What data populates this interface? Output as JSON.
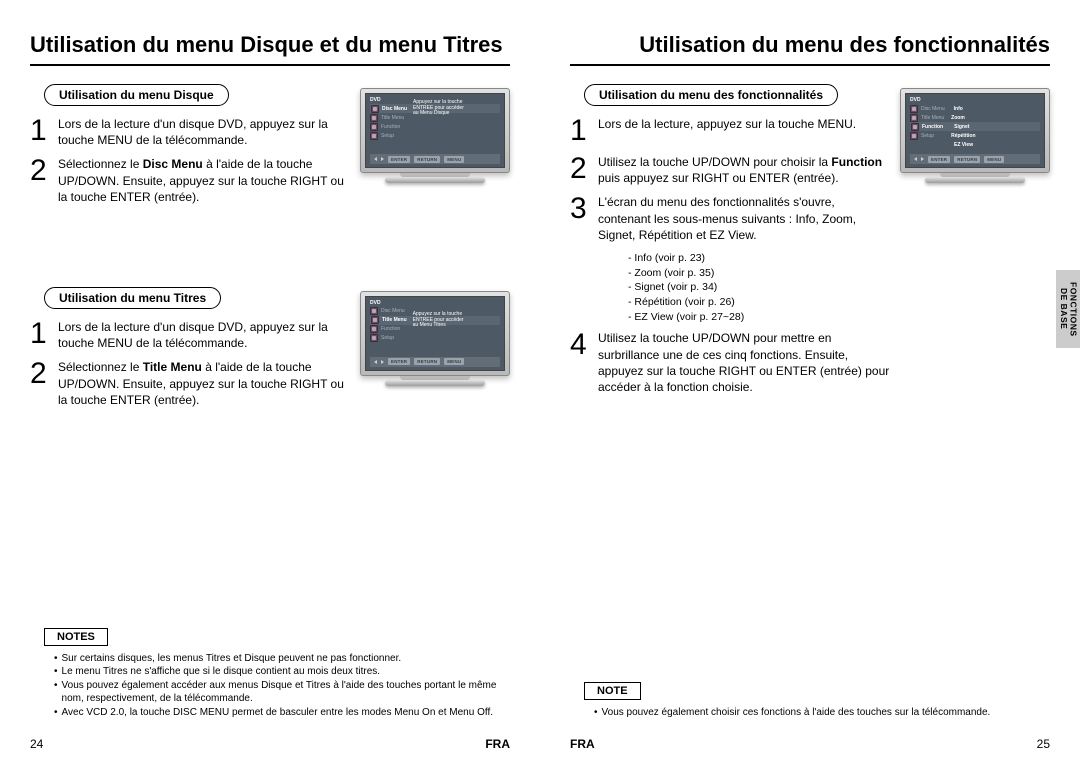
{
  "left": {
    "title": "Utilisation du menu Disque et du menu Titres",
    "sec1": {
      "pill": "Utilisation du menu Disque",
      "s1_num": "1",
      "s1_txt": "Lors de la lecture d'un disque DVD, appuyez sur la touche MENU de la télécommande.",
      "s2_num": "2",
      "s2_pre": "Sélectionnez le ",
      "s2_bold": "Disc Menu",
      "s2_post": " à l'aide de la touche UP/DOWN. Ensuite, appuyez sur la touche RIGHT ou la touche ENTER (entrée).",
      "tv": {
        "hdr": "DVD",
        "discmenu": "Disc Menu",
        "titlemenu": "Title Menu",
        "function": "Function",
        "setup": "Setup",
        "msg1": "Appuyez sur la touche",
        "msg2": "ENTREE pour accéder",
        "msg3": "au Menu Disque",
        "b1": "ENTER",
        "b2": "RETURN",
        "b3": "MENU"
      }
    },
    "sec2": {
      "pill": "Utilisation du menu Titres",
      "s1_num": "1",
      "s1_txt": "Lors de la lecture d'un disque DVD, appuyez sur la touche MENU de la télécommande.",
      "s2_num": "2",
      "s2_pre": "Sélectionnez le ",
      "s2_bold": "Title Menu",
      "s2_post": " à l'aide de la touche UP/DOWN. Ensuite, appuyez sur la touche RIGHT ou la touche ENTER (entrée).",
      "tv": {
        "hdr": "DVD",
        "discmenu": "Disc Menu",
        "titlemenu": "Title Menu",
        "function": "Function",
        "setup": "Setup",
        "msg1": "Appuyez sur la touche",
        "msg2": "ENTREE pour accéder",
        "msg3": "au Menu Titres",
        "b1": "ENTER",
        "b2": "RETURN",
        "b3": "MENU"
      }
    },
    "notes_label": "NOTES",
    "notes": {
      "n1": "Sur certains disques, les menus Titres et Disque peuvent ne pas fonctionner.",
      "n2": "Le menu Titres ne s'affiche que si le disque contient au mois deux titres.",
      "n3": "Vous pouvez également accéder aux menus Disque et Titres à l'aide des touches portant le même nom, respectivement, de la télécommande.",
      "n4": "Avec VCD 2.0, la touche DISC MENU permet de basculer entre les modes Menu On et Menu Off."
    },
    "pagenum": "24",
    "lang": "FRA"
  },
  "right": {
    "title": "Utilisation du menu des fonctionnalités",
    "pill": "Utilisation du menu des fonctionnalités",
    "s1_num": "1",
    "s1_txt": "Lors de la lecture, appuyez sur la touche MENU.",
    "s2_num": "2",
    "s2_pre": "Utilisez la touche UP/DOWN  pour choisir la ",
    "s2_bold": "Function",
    "s2_post": " puis appuyez sur RIGHT ou ENTER (entrée).",
    "s3_num": "3",
    "s3_txt": "L'écran du menu des fonctionnalités s'ouvre, contenant les sous-menus suivants : Info, Zoom, Signet, Répétition et EZ View.",
    "sub": {
      "i1": "- Info (voir p. 23)",
      "i2": "- Zoom (voir p. 35)",
      "i3": "- Signet (voir p. 34)",
      "i4": "- Répétition (voir p. 26)",
      "i5": "- EZ View (voir p. 27~28)"
    },
    "s4_num": "4",
    "s4_txt": "Utilisez la touche UP/DOWN pour mettre en surbrillance une de ces cinq fonctions. Ensuite, appuyez sur la touche RIGHT ou ENTER (entrée) pour accéder à la fonction choisie.",
    "tv": {
      "hdr": "DVD",
      "discmenu": "Disc Menu",
      "titlemenu": "Title Menu",
      "function": "Function",
      "setup": "Setup",
      "m1": "Info",
      "m2": "Zoom",
      "m3": "Signet",
      "m4": "Répétition",
      "m5": "EZ View",
      "b1": "ENTER",
      "b2": "RETURN",
      "b3": "MENU"
    },
    "note_label": "NOTE",
    "note1": "Vous pouvez également choisir ces fonctions à l'aide des touches sur la télécommande.",
    "pagenum": "25",
    "lang": "FRA",
    "sidetab": "FONCTIONS\nDE BASE"
  }
}
